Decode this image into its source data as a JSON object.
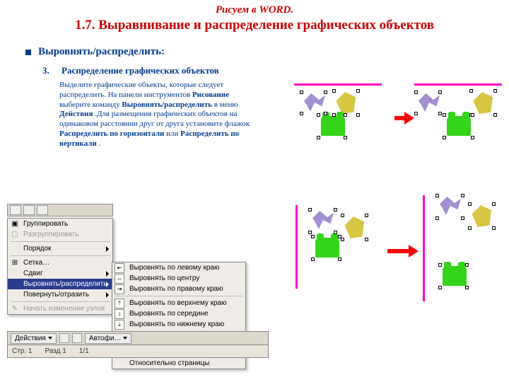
{
  "title": {
    "line1": "Рисуем в WORD.",
    "line2": "1.7. Выравнивание и распределение графических объектов"
  },
  "bullet": "Выровнять/распределить:",
  "step": {
    "num": "3.",
    "label": "Распределение графических объектов"
  },
  "body": {
    "p1a": "Выделите графические объекты, которые следует распределить. На панели инструментов ",
    "p1b_bold": "Рисование",
    "p1c": " выберите команду ",
    "p1d_bold": "Выровнять/распределить",
    "p1e": " в меню ",
    "p1f_bold": "Действия",
    "p1g": ".Для размещения графических объектов на одинаковом расстоянии друг от друга установите флажок ",
    "p1h_bold": "Распределить по горизонтали",
    "p1i": " или ",
    "p1j_bold": "Распределить по вертикали",
    "p1k": "."
  },
  "menu_main": {
    "group": "Группировать",
    "ungroup": "Разгруппировать",
    "order": "Порядок",
    "grid": "Сетка…",
    "nudge": "Сдвиг",
    "align": "Выровнять/распределить",
    "rotate": "Повернуть/отразить",
    "wrap": "Начать изменение узлов"
  },
  "menu_sub": {
    "left": "Выровнять по левому краю",
    "center": "Выровнять по центру",
    "right": "Выровнять по правому краю",
    "top": "Выровнять по верхнему краю",
    "middle": "Выровнять по середине",
    "bottom": "Выровнять по нижнему краю",
    "dist_h": "Распределить по горизонтали",
    "dist_v": "Распределить по вертикали",
    "rel_page": "Относительно страницы"
  },
  "draw_toolbar": {
    "actions": "Действия",
    "autoshapes": "Автофи…"
  },
  "status_bar": {
    "page": "Стр. 1",
    "section": "Разд 1",
    "pages": "1/1"
  }
}
